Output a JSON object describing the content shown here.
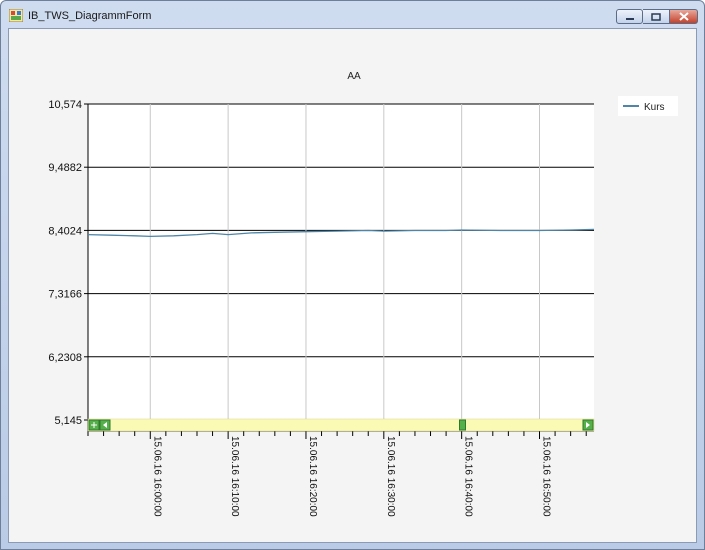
{
  "window": {
    "title": "IB_TWS_DiagrammForm",
    "icons": {
      "app": "app-window-icon",
      "minimize": "minimize-icon",
      "maximize": "maximize-icon",
      "close": "close-icon"
    }
  },
  "chart_data": {
    "type": "line",
    "title": "AA",
    "xlabel": "",
    "ylabel": "",
    "ylim": [
      5.145,
      10.574
    ],
    "y_ticks": [
      "10,574",
      "9,4882",
      "8,4024",
      "7,3166",
      "6,2308",
      "5,145"
    ],
    "y_tick_values": [
      10.574,
      9.4882,
      8.4024,
      7.3166,
      6.2308,
      5.145
    ],
    "x_range": [
      "15.06.16 15:52",
      "15.06.16 16:57"
    ],
    "x_tick_labels": [
      "15.06.16  16:00:00",
      "15.06.16  16:10:00",
      "15.06.16  16:20:00",
      "15.06.16  16:30:00",
      "15.06.16  16:40:00",
      "15.06.16  16:50:00"
    ],
    "grid": true,
    "legend_placement": "top-right",
    "series": [
      {
        "name": "Kurs",
        "color": "#4f86a8",
        "x": [
          "15:52",
          "15:55",
          "15:58",
          "16:00",
          "16:03",
          "16:06",
          "16:08",
          "16:10",
          "16:13",
          "16:16",
          "16:20",
          "16:24",
          "16:28",
          "16:30",
          "16:34",
          "16:38",
          "16:40",
          "16:45",
          "16:50",
          "16:54",
          "16:57"
        ],
        "values": [
          8.33,
          8.32,
          8.31,
          8.3,
          8.31,
          8.33,
          8.35,
          8.33,
          8.36,
          8.37,
          8.38,
          8.39,
          8.4,
          8.39,
          8.4,
          8.4,
          8.41,
          8.4,
          8.4,
          8.41,
          8.42
        ]
      }
    ],
    "scrollbar": {
      "thumb_position": 0.74
    }
  }
}
